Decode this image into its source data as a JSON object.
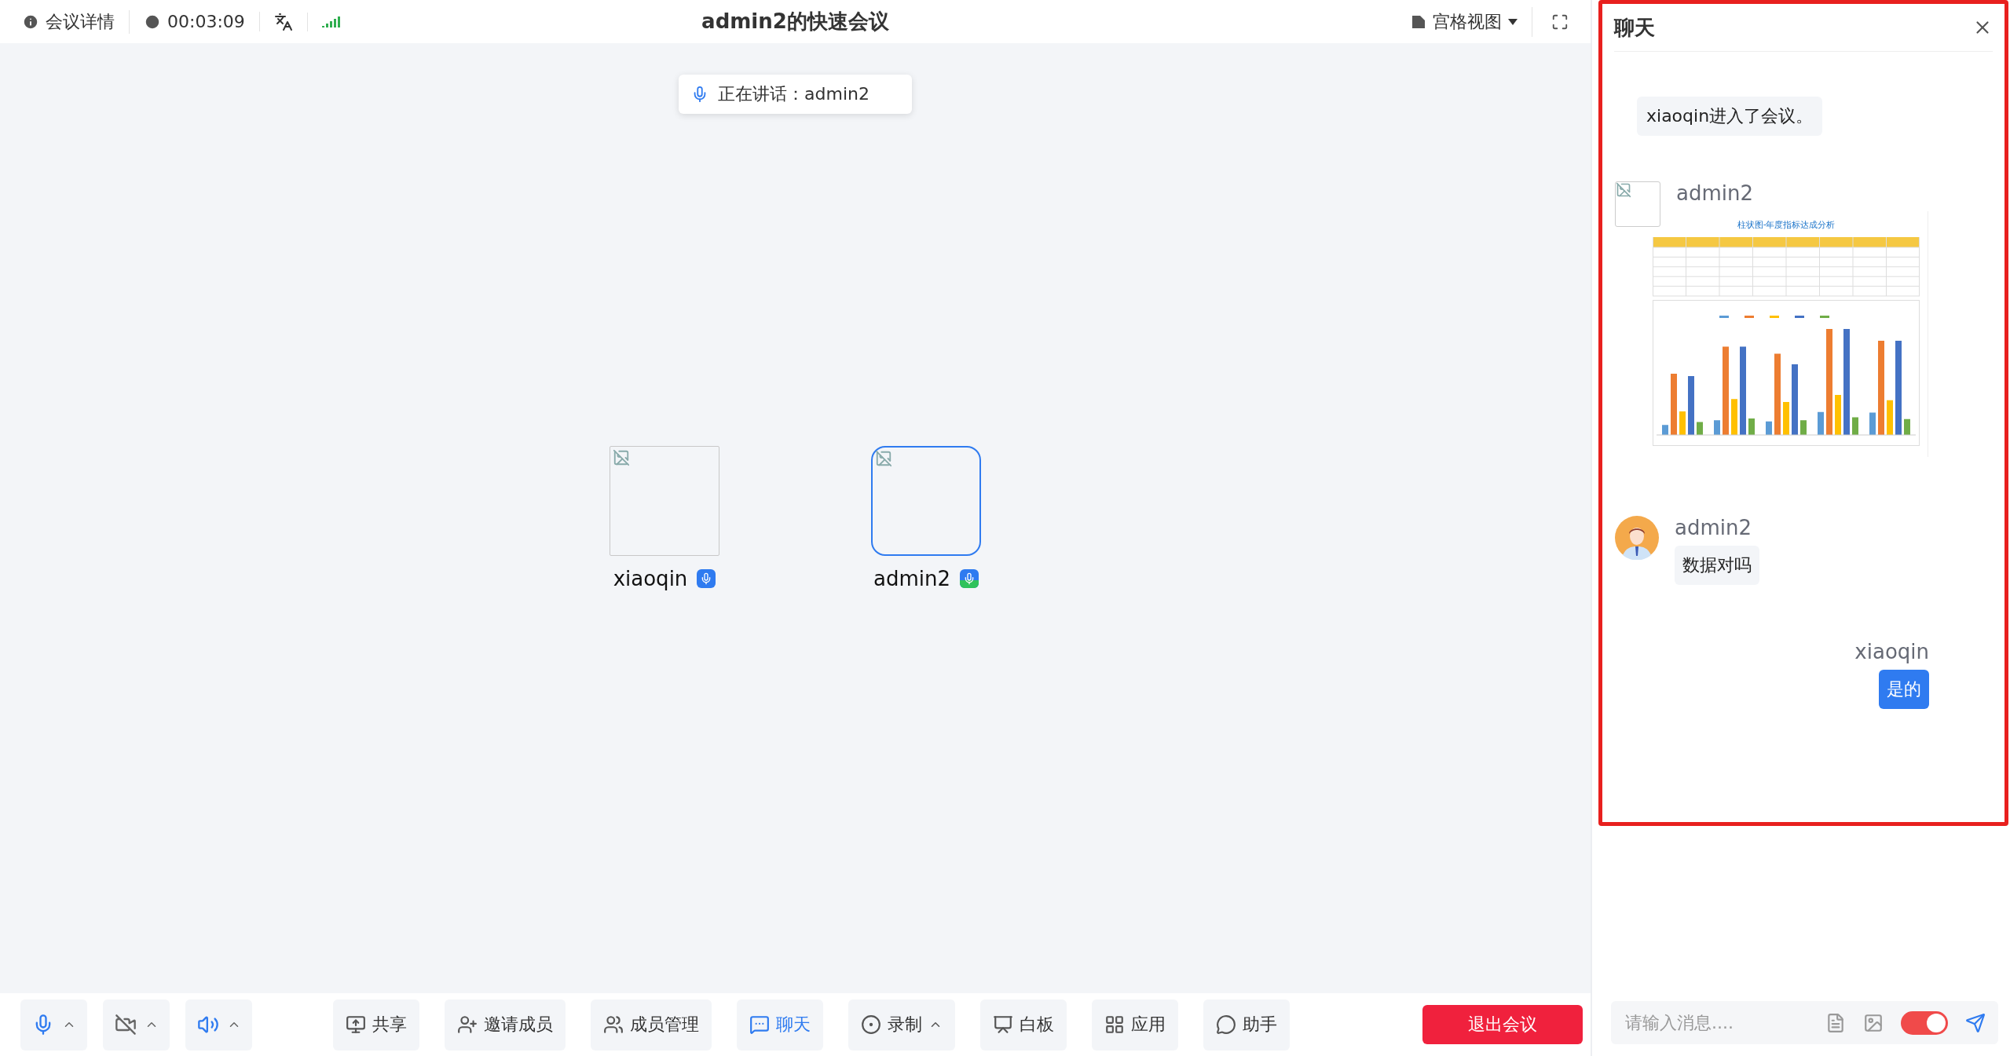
{
  "top_bar": {
    "meeting_info": "会议详情",
    "duration": "00:03:09",
    "title": "admin2的快速会议",
    "view_mode": "宫格视图"
  },
  "speaking_banner": {
    "label": "正在讲话：admin2"
  },
  "participants": [
    {
      "name": "xiaoqin",
      "speaking": false
    },
    {
      "name": "admin2",
      "speaking": true
    }
  ],
  "toolbar": {
    "devices": [
      {
        "kind": "microphone",
        "on": true
      },
      {
        "kind": "camera",
        "on": false
      },
      {
        "kind": "speaker",
        "on": true
      }
    ],
    "buttons": [
      {
        "kind": "share",
        "label": "共享",
        "selected": false
      },
      {
        "kind": "invite",
        "label": "邀请成员",
        "selected": false
      },
      {
        "kind": "members",
        "label": "成员管理",
        "selected": false
      },
      {
        "kind": "chat",
        "label": "聊天",
        "selected": true
      },
      {
        "kind": "record",
        "label": "录制",
        "selected": false
      },
      {
        "kind": "whiteboard",
        "label": "白板",
        "selected": false
      },
      {
        "kind": "apps",
        "label": "应用",
        "selected": false
      },
      {
        "kind": "assistant",
        "label": "助手",
        "selected": false
      }
    ],
    "leave": "退出会议"
  },
  "chat": {
    "title": "聊天",
    "highlighted": true,
    "messages": [
      {
        "kind": "system",
        "text": "xiaoqin进入了会议。"
      },
      {
        "kind": "image",
        "sender": "admin2",
        "avatar_loaded": false,
        "image_title": "柱状图-年度指标达成分析"
      },
      {
        "kind": "text",
        "sender": "admin2",
        "avatar_loaded": true,
        "text": "数据对吗",
        "mine": false
      },
      {
        "kind": "text",
        "sender": "xiaoqin",
        "text": "是的",
        "mine": true
      }
    ],
    "input": {
      "placeholder": "请输入消息....",
      "switch_on": true
    }
  }
}
